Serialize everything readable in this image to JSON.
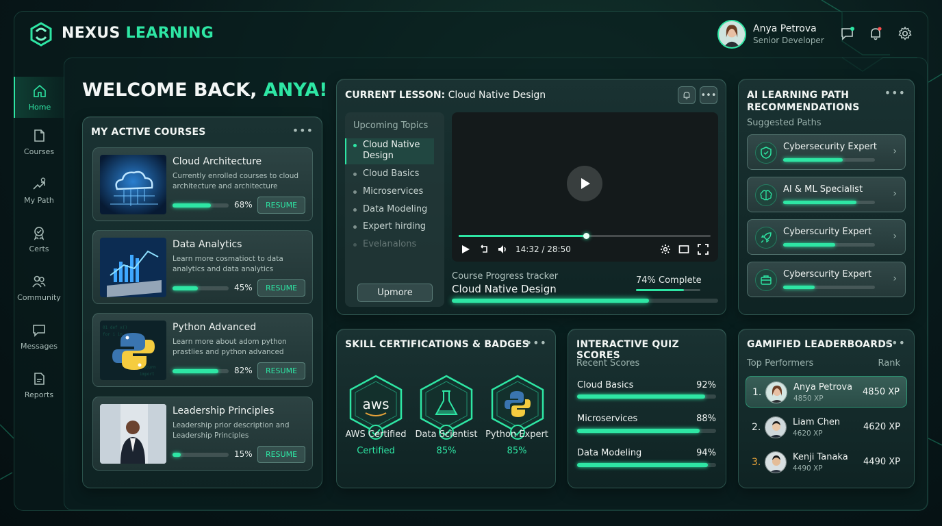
{
  "brand": {
    "part1": "NEXUS",
    "part2": "LEARNING"
  },
  "user": {
    "name": "Anya Petrova",
    "role": "Senior Developer"
  },
  "header_icons": [
    "chat-icon",
    "bell-icon",
    "gear-icon"
  ],
  "sidebar": {
    "items": [
      {
        "label": "Home",
        "icon": "home-icon",
        "active": true
      },
      {
        "label": "Courses",
        "icon": "book-icon"
      },
      {
        "label": "My Path",
        "icon": "path-icon"
      },
      {
        "label": "Certs",
        "icon": "certificate-icon"
      },
      {
        "label": "Community",
        "icon": "community-icon"
      },
      {
        "label": "Messages",
        "icon": "message-icon"
      },
      {
        "label": "Reports",
        "icon": "report-icon"
      }
    ]
  },
  "welcome": {
    "prefix": "WELCOME BACK, ",
    "name": "ANYA!"
  },
  "courses": {
    "title": "MY ACTIVE COURSES",
    "resume_label": "RESUME",
    "items": [
      {
        "title": "Cloud Architecture",
        "desc": "Currently enrolled courses to cloud architecture and architecture",
        "progress": 68,
        "pct": "68%"
      },
      {
        "title": "Data Analytics",
        "desc": "Learn more cosmatioct to data analytics and data analytics",
        "progress": 45,
        "pct": "45%"
      },
      {
        "title": "Python Advanced",
        "desc": "Learn more about adom python prastlies and python advanced",
        "progress": 82,
        "pct": "82%"
      },
      {
        "title": "Leadership Principles",
        "desc": "Leadership prior description and Leadership Principles",
        "progress": 15,
        "pct": "15%"
      }
    ]
  },
  "lesson": {
    "label": "CURRENT LESSON:",
    "name": "Cloud Native Design",
    "topics_title": "Upcoming Topics",
    "topics": [
      {
        "label": "Cloud Native Design",
        "active": true
      },
      {
        "label": "Cloud Basics"
      },
      {
        "label": "Microservices"
      },
      {
        "label": "Data Modeling"
      },
      {
        "label": "Expert hirding"
      },
      {
        "label": "Evelanalons",
        "faded": true
      }
    ],
    "more_button": "Upmore",
    "video": {
      "time": "14:32 / 28:50",
      "progress": 0.505
    },
    "tracker_label": "Course Progress tracker",
    "tracker_name": "Cloud Native Design",
    "tracker_pct": "74% Complete",
    "tracker_progress": 74
  },
  "ai_paths": {
    "title_line1": "AI LEARNING PATH",
    "title_line2": "RECOMMENDATIONS",
    "subtitle": "Suggested Paths",
    "items": [
      {
        "label": "Cybersecurity Expert",
        "icon": "shield-icon",
        "progress": 65
      },
      {
        "label": "AI & ML Specialist",
        "icon": "brain-icon",
        "progress": 80
      },
      {
        "label": "Cyberscurity Expert",
        "icon": "rocket-icon",
        "progress": 57
      },
      {
        "label": "Cyberscurity Expert",
        "icon": "briefcase-icon",
        "progress": 34
      }
    ]
  },
  "certs": {
    "title": "SKILL CERTIFICATIONS & BADGES",
    "badges": [
      {
        "label": "AWS Certified",
        "value": "Certified",
        "icon": "aws-logo-icon",
        "logo_text": "aws"
      },
      {
        "label": "Data Scientist",
        "value": "85%",
        "icon": "flask-icon"
      },
      {
        "label": "Python Expert",
        "value": "85%",
        "icon": "python-icon"
      }
    ]
  },
  "quiz": {
    "title": "INTERACTIVE QUIZ SCORES",
    "subtitle": "Recent Scores",
    "items": [
      {
        "name": "Cloud Basics",
        "pct": "92%",
        "value": 92
      },
      {
        "name": "Microservices",
        "pct": "88%",
        "value": 88
      },
      {
        "name": "Data Modeling",
        "pct": "94%",
        "value": 94
      }
    ]
  },
  "leaderboard": {
    "title": "GAMIFIED LEADERBOARDS",
    "subtitle": "Top Performers",
    "rank_header": "Rank",
    "rows": [
      {
        "rank": "1.",
        "name": "Anya Petrova",
        "xp_small": "4850 XP",
        "xp": "4850 XP"
      },
      {
        "rank": "2.",
        "name": "Liam Chen",
        "xp_small": "4620 XP",
        "xp": "4620 XP"
      },
      {
        "rank": "3.",
        "name": "Kenji Tanaka",
        "xp_small": "4490 XP",
        "xp": "4490 XP"
      }
    ]
  },
  "colors": {
    "accent": "#2ee6a4",
    "bronze": "#e8a33a",
    "bg": "#08181a"
  }
}
